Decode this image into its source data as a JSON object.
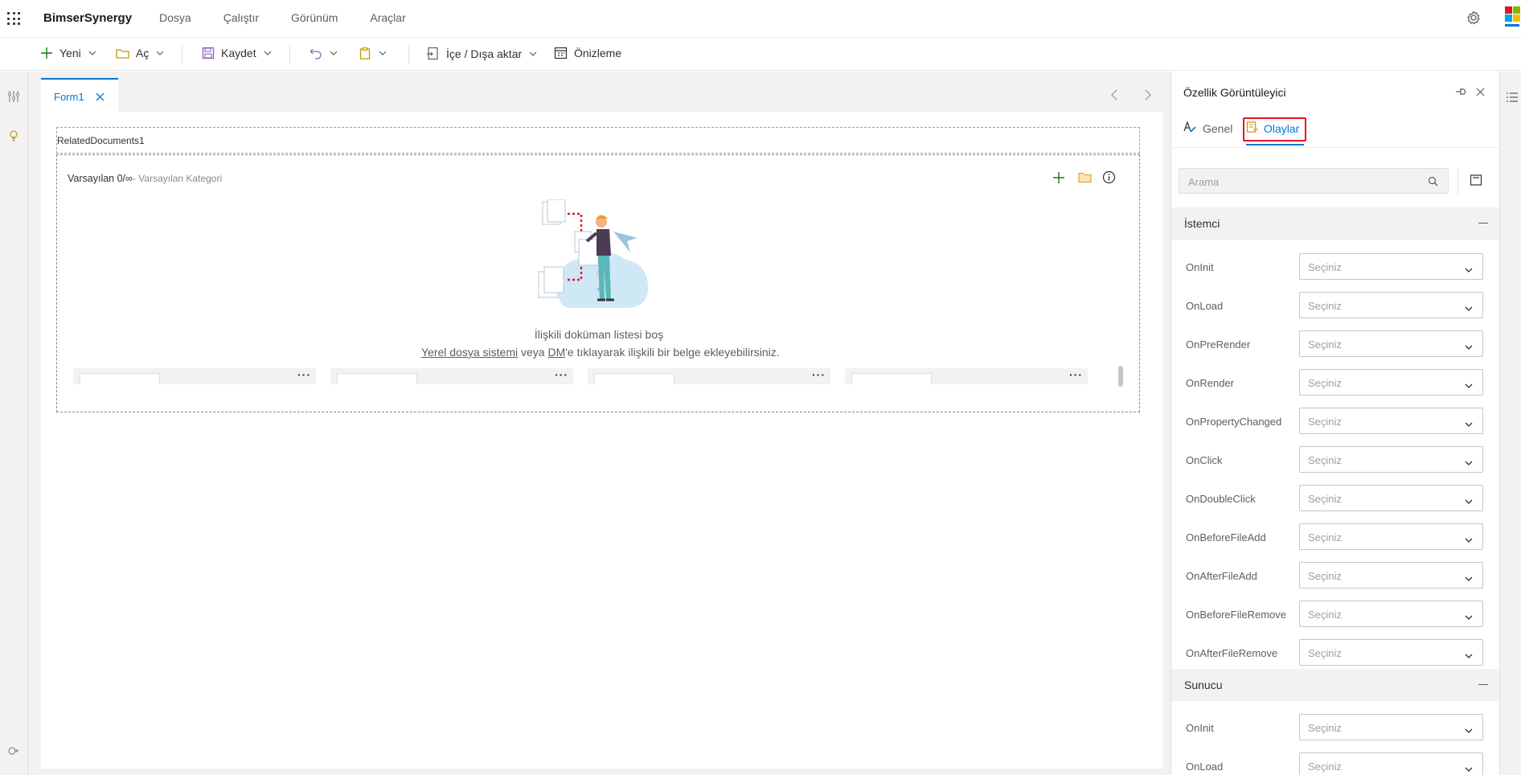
{
  "topbar": {
    "brand": "BimserSynergy",
    "menu": [
      "Dosya",
      "Çalıştır",
      "Görünüm",
      "Araçlar"
    ]
  },
  "commands": {
    "new": "Yeni",
    "open": "Aç",
    "save": "Kaydet",
    "import_export": "İçe / Dışa aktar",
    "preview": "Önizleme"
  },
  "tabs": [
    {
      "label": "Form1",
      "active": true
    }
  ],
  "designer": {
    "control_name": "RelatedDocuments1",
    "category_title": "Varsayılan 0/∞",
    "category_sub": "- Varsayılan Kategori",
    "empty_title": "İlişkili doküman listesi boş",
    "empty_link1": "Yerel dosya sistemi",
    "empty_mid1": " veya ",
    "empty_link2": "DM",
    "empty_tail": "'e tıklayarak ilişkili bir belge ekleyebilirsiniz.",
    "cards": [
      {
        "more": "···"
      },
      {
        "more": "···"
      },
      {
        "more": "···"
      },
      {
        "more": "···"
      }
    ]
  },
  "panel": {
    "title": "Özellik Görüntüleyici",
    "tab_general": "Genel",
    "tab_events": "Olaylar",
    "active_tab": "Olaylar",
    "search_placeholder": "Arama",
    "sections": [
      {
        "title": "İstemci",
        "rows": [
          {
            "label": "OnInit",
            "value": "Seçiniz"
          },
          {
            "label": "OnLoad",
            "value": "Seçiniz"
          },
          {
            "label": "OnPreRender",
            "value": "Seçiniz"
          },
          {
            "label": "OnRender",
            "value": "Seçiniz"
          },
          {
            "label": "OnPropertyChanged",
            "value": "Seçiniz"
          },
          {
            "label": "OnClick",
            "value": "Seçiniz"
          },
          {
            "label": "OnDoubleClick",
            "value": "Seçiniz"
          },
          {
            "label": "OnBeforeFileAdd",
            "value": "Seçiniz"
          },
          {
            "label": "OnAfterFileAdd",
            "value": "Seçiniz"
          },
          {
            "label": "OnBeforeFileRemove",
            "value": "Seçiniz"
          },
          {
            "label": "OnAfterFileRemove",
            "value": "Seçiniz"
          }
        ]
      },
      {
        "title": "Sunucu",
        "rows": [
          {
            "label": "OnInit",
            "value": "Seçiniz"
          },
          {
            "label": "OnLoad",
            "value": "Seçiniz"
          }
        ]
      }
    ]
  },
  "colors": {
    "accent": "#0078d4",
    "highlight": "#e81123",
    "add_green": "#107c10",
    "folder": "#e8a33d"
  }
}
